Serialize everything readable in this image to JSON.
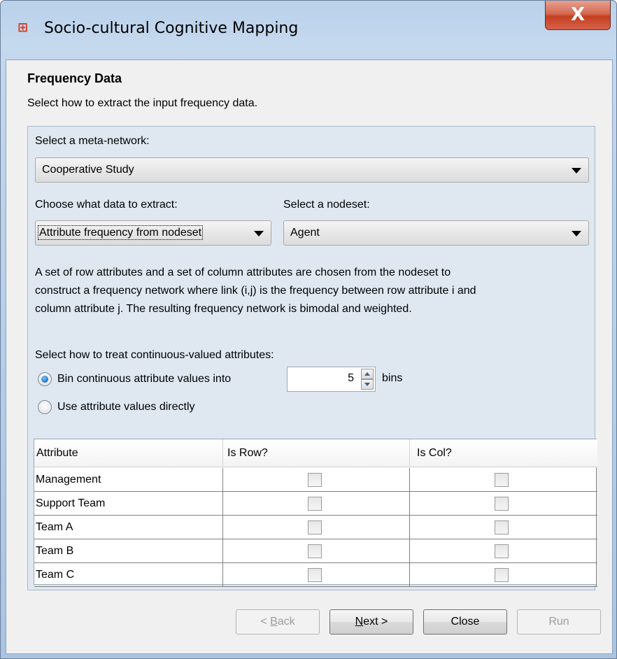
{
  "window": {
    "title": "Socio-cultural Cognitive Mapping",
    "close_label": "X"
  },
  "header": {
    "title": "Frequency Data",
    "subtitle": "Select how to extract the input frequency data."
  },
  "meta_network": {
    "label": "Select a meta-network:",
    "selected": "Cooperative Study"
  },
  "extract": {
    "label": "Choose what data to extract:",
    "selected": "Attribute frequency from nodeset"
  },
  "nodeset": {
    "label": "Select a nodeset:",
    "selected": "Agent"
  },
  "description_lines": [
    "A set of row attributes and a set of column attributes are chosen from the nodeset to",
    "construct a frequency network where link (i,j) is the frequency between row attribute i and",
    "column attribute j. The resulting frequency network is bimodal and weighted."
  ],
  "continuous": {
    "label": "Select how to treat continuous-valued attributes:",
    "option_bin": "Bin continuous attribute values into",
    "bin_count": "5",
    "bins_suffix": "bins",
    "option_direct": "Use attribute values directly",
    "selected": "bin"
  },
  "table": {
    "headers": [
      "Attribute",
      "Is Row?",
      "Is Col?"
    ],
    "rows": [
      {
        "attribute": "Management",
        "is_row": false,
        "is_col": false
      },
      {
        "attribute": "Support Team",
        "is_row": false,
        "is_col": false
      },
      {
        "attribute": "Team A",
        "is_row": false,
        "is_col": false
      },
      {
        "attribute": "Team B",
        "is_row": false,
        "is_col": false
      },
      {
        "attribute": "Team C",
        "is_row": false,
        "is_col": false
      }
    ]
  },
  "buttons": {
    "back": {
      "prefix": "< ",
      "mnemonic": "B",
      "rest": "ack",
      "enabled": false
    },
    "next": {
      "mnemonic": "N",
      "rest": "ext >",
      "enabled": true
    },
    "close": {
      "label": "Close",
      "enabled": true
    },
    "run": {
      "label": "Run",
      "enabled": false
    }
  },
  "colors": {
    "window_frame": "#b9d1ea",
    "close_button": "#c2401f",
    "panel_bg": "#dfe8f1",
    "radio_selected": "#2a7fd4"
  }
}
